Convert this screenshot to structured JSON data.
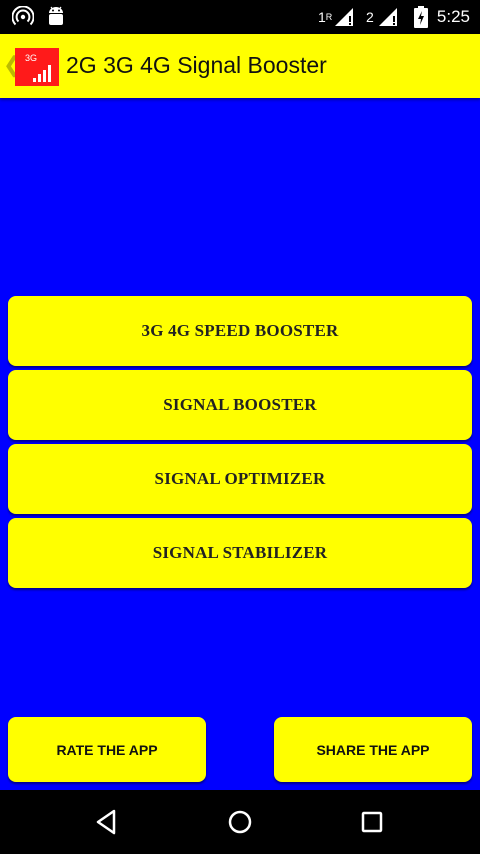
{
  "status_bar": {
    "time": "5:25",
    "sim1_label": "1",
    "sim1_roaming": "R",
    "sim2_label": "2",
    "icons": [
      "hotspot-icon",
      "android-icon",
      "signal-icon",
      "battery-icon"
    ]
  },
  "app_bar": {
    "logo_text": "3G",
    "title": "2G 3G 4G Signal Booster"
  },
  "menu": {
    "speed_booster": "3G 4G SPEED BOOSTER",
    "signal_booster": "SIGNAL BOOSTER",
    "signal_optimizer": "SIGNAL OPTIMIZER",
    "signal_stabilizer": "SIGNAL STABILIZER"
  },
  "footer": {
    "rate": "RATE THE APP",
    "share": "SHARE THE APP"
  },
  "colors": {
    "background": "#0000ff",
    "accent": "#ffff00",
    "logo": "#ff1a1a"
  }
}
